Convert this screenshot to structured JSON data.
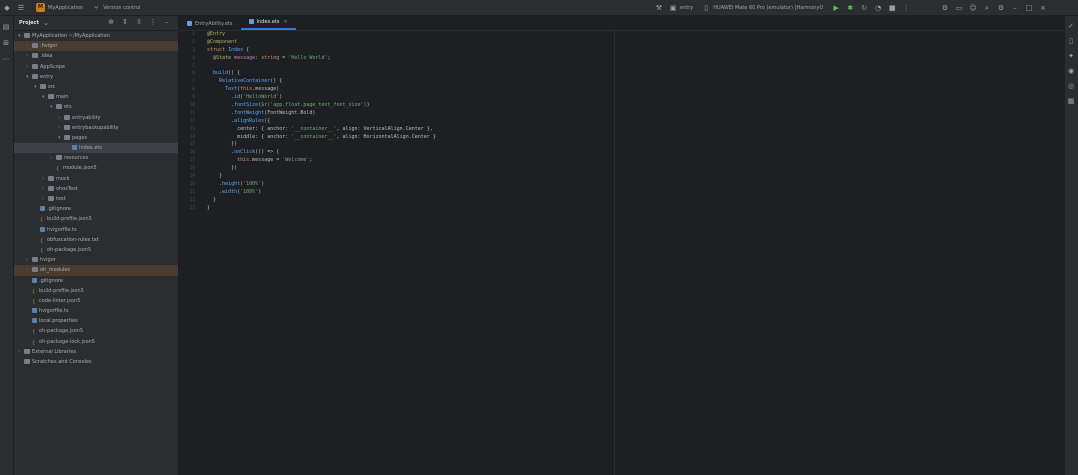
{
  "titlebar": {
    "project_badge": "M",
    "project_name": "MyApplication",
    "branch": "Version control",
    "run_config": "entry",
    "device": "HUAWEI Mate 60 Pro (emulator) [HarmonyOS]",
    "icons": [
      "menu-icon",
      "hamburger-icon"
    ]
  },
  "project_panel": {
    "title": "Project",
    "tree": [
      {
        "depth": 0,
        "arrow": "▾",
        "icon": "folder",
        "label": "MyApplication  ~/MyApplication",
        "hl": false
      },
      {
        "depth": 1,
        "arrow": "›",
        "icon": "folder",
        "label": ".hvigor",
        "hl": true
      },
      {
        "depth": 1,
        "arrow": "›",
        "icon": "folder",
        "label": ".idea",
        "hl": false
      },
      {
        "depth": 1,
        "arrow": "›",
        "icon": "folder",
        "label": "AppScope",
        "hl": false
      },
      {
        "depth": 1,
        "arrow": "▾",
        "icon": "folder",
        "label": "entry",
        "hl": false
      },
      {
        "depth": 2,
        "arrow": "▾",
        "icon": "folder",
        "label": "src",
        "hl": false
      },
      {
        "depth": 3,
        "arrow": "▾",
        "icon": "folder",
        "label": "main",
        "hl": false
      },
      {
        "depth": 4,
        "arrow": "▾",
        "icon": "folder",
        "label": "ets",
        "hl": false
      },
      {
        "depth": 5,
        "arrow": "›",
        "icon": "folder",
        "label": "entryability",
        "hl": false
      },
      {
        "depth": 5,
        "arrow": "›",
        "icon": "folder",
        "label": "entrybackupability",
        "hl": false
      },
      {
        "depth": 5,
        "arrow": "▾",
        "icon": "folder",
        "label": "pages",
        "hl": false
      },
      {
        "depth": 6,
        "arrow": "",
        "icon": "file",
        "label": "Index.ets",
        "sel": true
      },
      {
        "depth": 4,
        "arrow": "›",
        "icon": "folder",
        "label": "resources",
        "hl": false
      },
      {
        "depth": 4,
        "arrow": "",
        "icon": "json",
        "label": "module.json5",
        "hl": false
      },
      {
        "depth": 3,
        "arrow": "›",
        "icon": "folder",
        "label": "mock",
        "hl": false
      },
      {
        "depth": 3,
        "arrow": "›",
        "icon": "folder",
        "label": "ohosTest",
        "hl": false
      },
      {
        "depth": 3,
        "arrow": "›",
        "icon": "folder",
        "label": "test",
        "hl": false
      },
      {
        "depth": 2,
        "arrow": "",
        "icon": "file",
        "label": ".gitignore",
        "hl": false
      },
      {
        "depth": 2,
        "arrow": "",
        "icon": "json",
        "label": "build-profile.json5",
        "hl": false
      },
      {
        "depth": 2,
        "arrow": "",
        "icon": "file",
        "label": "hvigorfile.ts",
        "hl": false
      },
      {
        "depth": 2,
        "arrow": "",
        "icon": "json",
        "label": "obfuscation-rules.txt",
        "hl": false
      },
      {
        "depth": 2,
        "arrow": "",
        "icon": "json",
        "label": "oh-package.json5",
        "hl": false
      },
      {
        "depth": 1,
        "arrow": "›",
        "icon": "folder",
        "label": "hvigor",
        "hl": false
      },
      {
        "depth": 1,
        "arrow": "›",
        "icon": "folder",
        "label": "oh_modules",
        "hl": true
      },
      {
        "depth": 1,
        "arrow": "",
        "icon": "file",
        "label": ".gitignore",
        "hl": false
      },
      {
        "depth": 1,
        "arrow": "",
        "icon": "json",
        "label": "build-profile.json5",
        "hl": false
      },
      {
        "depth": 1,
        "arrow": "",
        "icon": "json",
        "label": "code-linter.json5",
        "hl": false
      },
      {
        "depth": 1,
        "arrow": "",
        "icon": "file",
        "label": "hvigorfile.ts",
        "hl": false
      },
      {
        "depth": 1,
        "arrow": "",
        "icon": "file",
        "label": "local.properties",
        "hl": false
      },
      {
        "depth": 1,
        "arrow": "",
        "icon": "json",
        "label": "oh-package.json5",
        "hl": false
      },
      {
        "depth": 1,
        "arrow": "",
        "icon": "json",
        "label": "oh-package-lock.json5",
        "hl": false
      },
      {
        "depth": 0,
        "arrow": "›",
        "icon": "folder",
        "label": "External Libraries",
        "hl": false
      },
      {
        "depth": 0,
        "arrow": "",
        "icon": "folder",
        "label": "Scratches and Consoles",
        "hl": false
      }
    ]
  },
  "editor": {
    "tabs": [
      {
        "label": "EntryAbility.ets",
        "active": false
      },
      {
        "label": "Index.ets",
        "active": true
      }
    ],
    "lines": [
      [
        [
          "dec",
          "@Entry"
        ]
      ],
      [
        [
          "dec",
          "@Component"
        ]
      ],
      [
        [
          "kw",
          "struct "
        ],
        [
          "fn",
          "Index "
        ],
        [
          "",
          "{"
        ]
      ],
      [
        [
          "",
          "  "
        ],
        [
          "dec",
          "@State "
        ],
        [
          "prop",
          "message"
        ],
        [
          "",
          ": "
        ],
        [
          "kw",
          "string "
        ],
        [
          "",
          "= "
        ],
        [
          "str",
          "'Hello World'"
        ],
        [
          "",
          ";"
        ]
      ],
      [
        [
          "",
          ""
        ]
      ],
      [
        [
          "",
          "  "
        ],
        [
          "fn",
          "build"
        ],
        [
          "",
          "() {"
        ]
      ],
      [
        [
          "",
          "    "
        ],
        [
          "fn",
          "RelativeContainer"
        ],
        [
          "",
          "() {"
        ]
      ],
      [
        [
          "",
          "      "
        ],
        [
          "fn",
          "Text"
        ],
        [
          "",
          "("
        ],
        [
          "kw",
          "this"
        ],
        [
          "",
          ".message)"
        ]
      ],
      [
        [
          "",
          "        ."
        ],
        [
          "fn",
          "id"
        ],
        [
          "",
          "("
        ],
        [
          "str",
          "'HelloWorld'"
        ],
        [
          "",
          ")"
        ]
      ],
      [
        [
          "",
          "        ."
        ],
        [
          "fn",
          "fontSize"
        ],
        [
          "",
          "("
        ],
        [
          "str",
          "$r('app.float.page_text_font_size')"
        ],
        [
          "",
          ")"
        ]
      ],
      [
        [
          "",
          "        ."
        ],
        [
          "fn",
          "fontWeight"
        ],
        [
          "",
          "(FontWeight.Bold)"
        ]
      ],
      [
        [
          "",
          "        ."
        ],
        [
          "fn",
          "alignRules"
        ],
        [
          "",
          "({"
        ]
      ],
      [
        [
          "",
          "          center: { anchor: "
        ],
        [
          "str",
          "'__container__'"
        ],
        [
          "",
          ", align: VerticalAlign.Center },"
        ]
      ],
      [
        [
          "",
          "          middle: { anchor: "
        ],
        [
          "str",
          "'__container__'"
        ],
        [
          "",
          ", align: HorizontalAlign.Center }"
        ]
      ],
      [
        [
          "",
          "        })"
        ]
      ],
      [
        [
          "",
          "        ."
        ],
        [
          "fn",
          "onClick"
        ],
        [
          "",
          "(() => {"
        ]
      ],
      [
        [
          "",
          "          "
        ],
        [
          "kw",
          "this"
        ],
        [
          "",
          ".message = "
        ],
        [
          "str",
          "'Welcome'"
        ],
        [
          "",
          ";"
        ]
      ],
      [
        [
          "",
          "        })"
        ]
      ],
      [
        [
          "",
          "    }"
        ]
      ],
      [
        [
          "",
          "    ."
        ],
        [
          "fn",
          "height"
        ],
        [
          "",
          "("
        ],
        [
          "str",
          "'100%'"
        ],
        [
          "",
          ")"
        ]
      ],
      [
        [
          "",
          "    ."
        ],
        [
          "fn",
          "width"
        ],
        [
          "",
          "("
        ],
        [
          "str",
          "'100%'"
        ],
        [
          "",
          ")"
        ]
      ],
      [
        [
          "",
          "  }"
        ]
      ],
      [
        [
          "",
          "}"
        ]
      ]
    ]
  }
}
